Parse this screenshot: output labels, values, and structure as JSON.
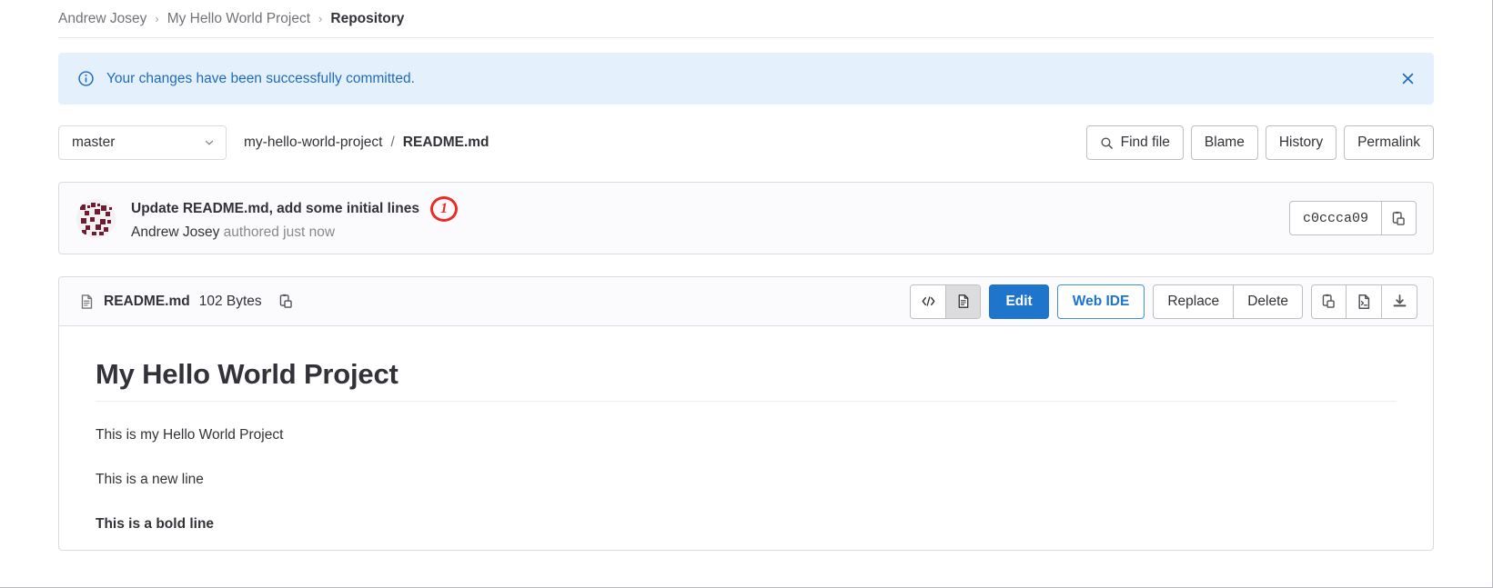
{
  "breadcrumb": {
    "items": [
      {
        "label": "Andrew Josey",
        "current": false
      },
      {
        "label": "My Hello World Project",
        "current": false
      },
      {
        "label": "Repository",
        "current": true
      }
    ],
    "separator": "›"
  },
  "alert": {
    "icon": "info-circle-icon",
    "message": "Your changes have been successfully committed.",
    "close_label": "×",
    "background_color": "#e4f0fb",
    "text_color": "#1f6cbf"
  },
  "ref_row": {
    "branch": "master",
    "branch_icon": "chevron-down-icon",
    "path_dir": "my-hello-world-project",
    "path_separator": "/",
    "path_file": "README.md",
    "actions": [
      {
        "label": "Find file",
        "icon": "search-icon"
      },
      {
        "label": "Blame",
        "icon": ""
      },
      {
        "label": "History",
        "icon": ""
      },
      {
        "label": "Permalink",
        "icon": ""
      }
    ]
  },
  "commit": {
    "avatar_name": "identicon-avatar",
    "title": "Update README.md, add some initial lines",
    "annotation": "1",
    "annotation_color": "#ee2a24",
    "author": "Andrew Josey",
    "authored_text": "authored just now",
    "sha": "c0ccca09",
    "copy_icon": "copy-clipboard-icon"
  },
  "file": {
    "icon": "document-icon",
    "name": "README.md",
    "size": "102 Bytes",
    "copy_path_icon": "copy-clipboard-icon",
    "view_toggle": [
      {
        "name": "source-view",
        "icon": "code-brackets-icon",
        "active": false
      },
      {
        "name": "rendered-view",
        "icon": "document-icon",
        "active": true
      }
    ],
    "edit_label": "Edit",
    "web_ide_label": "Web IDE",
    "replace_label": "Replace",
    "delete_label": "Delete",
    "trailing_icons": [
      {
        "name": "copy-contents-icon"
      },
      {
        "name": "open-raw-icon"
      },
      {
        "name": "download-icon"
      }
    ],
    "primary_color": "#1f75cb"
  },
  "markdown": {
    "heading": "My Hello World Project",
    "paragraphs": [
      {
        "text": "This is my Hello World Project",
        "bold": false
      },
      {
        "text": "This is a new line",
        "bold": false
      },
      {
        "text": "This is a bold line",
        "bold": true
      }
    ]
  }
}
